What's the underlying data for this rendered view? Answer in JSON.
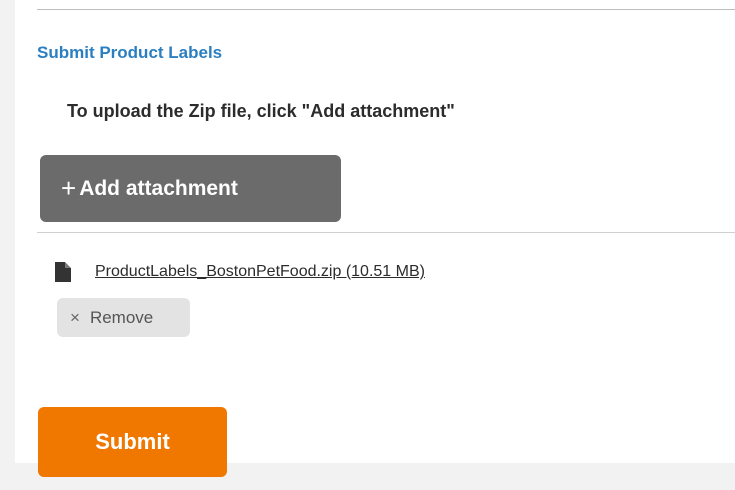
{
  "section": {
    "title": "Submit Product Labels",
    "instruction": "To upload the Zip file, click \"Add attachment\""
  },
  "attachment": {
    "add_icon": "+",
    "add_label": "Add attachment",
    "file_icon": "file-icon",
    "file_name": "ProductLabels_BostonPetFood.zip (10.51 MB)",
    "remove_icon": "×",
    "remove_label": "Remove"
  },
  "form": {
    "submit_label": "Submit"
  },
  "colors": {
    "title": "#2b7fc0",
    "add_button": "#6b6b6b",
    "submit_button": "#f07800",
    "remove_button": "#e3e3e3"
  }
}
